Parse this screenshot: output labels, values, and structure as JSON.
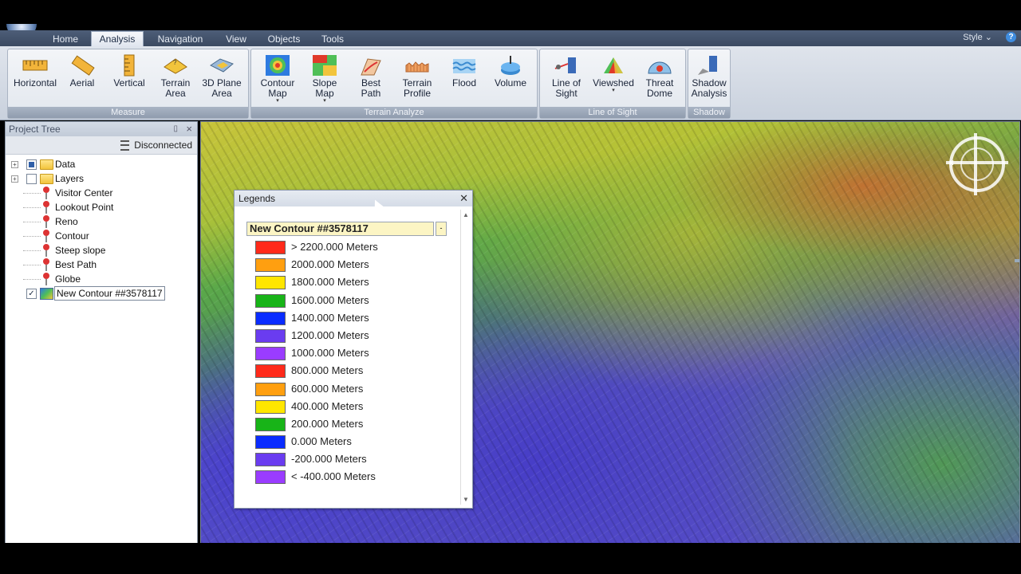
{
  "tabs": [
    "Home",
    "Analysis",
    "Navigation",
    "View",
    "Objects",
    "Tools"
  ],
  "active_tab": "Analysis",
  "topbar": {
    "style_label": "Style",
    "help_glyph": "?"
  },
  "ribbon": {
    "measure": {
      "label": "Measure",
      "buttons": [
        {
          "label": "Horizontal",
          "icon": "ruler-horizontal-icon"
        },
        {
          "label": "Aerial",
          "icon": "ruler-aerial-icon"
        },
        {
          "label": "Vertical",
          "icon": "ruler-vertical-icon"
        },
        {
          "label": "Terrain\nArea",
          "icon": "terrain-area-icon"
        },
        {
          "label": "3D Plane\nArea",
          "icon": "plane-area-icon"
        }
      ]
    },
    "terrain": {
      "label": "Terrain Analyze",
      "buttons": [
        {
          "label": "Contour\nMap",
          "icon": "contour-map-icon",
          "dropdown": true
        },
        {
          "label": "Slope\nMap",
          "icon": "slope-map-icon",
          "dropdown": true
        },
        {
          "label": "Best\nPath",
          "icon": "best-path-icon"
        },
        {
          "label": "Terrain\nProfile",
          "icon": "terrain-profile-icon"
        },
        {
          "label": "Flood",
          "icon": "flood-icon"
        },
        {
          "label": "Volume",
          "icon": "volume-icon"
        }
      ]
    },
    "los": {
      "label": "Line of Sight",
      "buttons": [
        {
          "label": "Line of\nSight",
          "icon": "line-of-sight-icon"
        },
        {
          "label": "Viewshed",
          "icon": "viewshed-icon",
          "dropdown": true
        },
        {
          "label": "Threat\nDome",
          "icon": "threat-dome-icon"
        }
      ]
    },
    "shadow": {
      "label": "Shadow",
      "buttons": [
        {
          "label": "Shadow\nAnalysis",
          "icon": "shadow-analysis-icon"
        }
      ]
    }
  },
  "project_tree": {
    "title": "Project Tree",
    "status": "Disconnected",
    "items": [
      {
        "label": "Data",
        "kind": "folder",
        "expandable": true,
        "check": "partial"
      },
      {
        "label": "Layers",
        "kind": "folder",
        "expandable": true,
        "check": "none"
      },
      {
        "label": "Visitor Center",
        "kind": "pin"
      },
      {
        "label": "Lookout Point",
        "kind": "pin"
      },
      {
        "label": "Reno",
        "kind": "pin"
      },
      {
        "label": "Contour",
        "kind": "pin"
      },
      {
        "label": "Steep slope",
        "kind": "pin"
      },
      {
        "label": "Best Path",
        "kind": "pin"
      },
      {
        "label": "Globe",
        "kind": "pin"
      },
      {
        "label": "New Contour ##3578117",
        "kind": "map",
        "check": "checked",
        "selected": true
      }
    ]
  },
  "legend": {
    "title": "Legends",
    "selected_layer": "New Contour ##3578117",
    "items": [
      {
        "label": "> 2200.000 Meters",
        "color": "#ff2a1a"
      },
      {
        "label": "2000.000 Meters",
        "color": "#ff9f10"
      },
      {
        "label": "1800.000 Meters",
        "color": "#ffe600"
      },
      {
        "label": "1600.000 Meters",
        "color": "#18b418"
      },
      {
        "label": "1400.000 Meters",
        "color": "#0a2cff"
      },
      {
        "label": "1200.000 Meters",
        "color": "#6a3cf0"
      },
      {
        "label": "1000.000 Meters",
        "color": "#9a3cff"
      },
      {
        "label": "800.000 Meters",
        "color": "#ff2a1a"
      },
      {
        "label": "600.000 Meters",
        "color": "#ff9f10"
      },
      {
        "label": "400.000 Meters",
        "color": "#ffe600"
      },
      {
        "label": "200.000 Meters",
        "color": "#18b418"
      },
      {
        "label": "0.000 Meters",
        "color": "#0a2cff"
      },
      {
        "label": "-200.000 Meters",
        "color": "#6a3cf0"
      },
      {
        "label": "< -400.000 Meters",
        "color": "#9a3cff"
      }
    ]
  }
}
